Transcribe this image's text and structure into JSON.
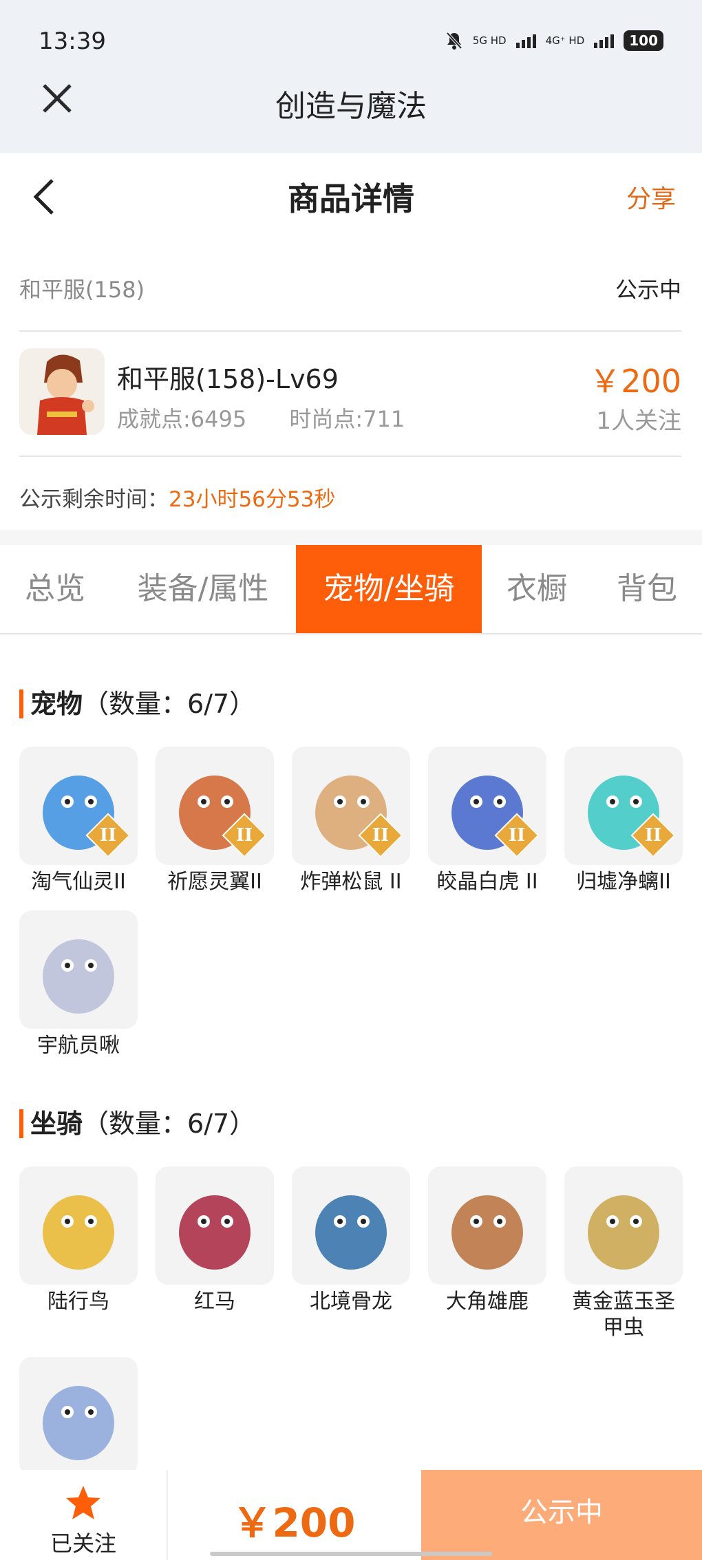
{
  "status_bar": {
    "time": "13:39",
    "net1": "5G HD",
    "net2": "4G⁺ HD",
    "battery": "100"
  },
  "app_bar": {
    "title": "创造与魔法"
  },
  "header": {
    "title": "商品详情",
    "share_label": "分享"
  },
  "listing": {
    "server": "和平服(158)",
    "status": "公示中",
    "character": "和平服(158)-Lv69",
    "achievement": "成就点:6495",
    "fashion": "时尚点:711",
    "price": "￥200",
    "followers": "1人关注",
    "timer_label": "公示剩余时间：",
    "timer_value": "23小时56分53秒"
  },
  "tabs": [
    {
      "label": "总览"
    },
    {
      "label": "装备/属性"
    },
    {
      "label": "宠物/坐骑",
      "active": true
    },
    {
      "label": "衣橱"
    },
    {
      "label": "背包"
    }
  ],
  "pets": {
    "title": "宠物",
    "count": "（数量：6/7）",
    "items": [
      {
        "name": "淘气仙灵II",
        "badge": "II",
        "color": "#3b8fe0"
      },
      {
        "name": "祈愿灵翼II",
        "badge": "II",
        "color": "#d0612b"
      },
      {
        "name": "炸弹松鼠 II",
        "badge": "II",
        "color": "#d9a36a"
      },
      {
        "name": "皎晶白虎 II",
        "badge": "II",
        "color": "#3f63c9"
      },
      {
        "name": "归墟净螭II",
        "badge": "II",
        "color": "#36c7c2"
      },
      {
        "name": "宇航员啾",
        "color": "#b9bdd8"
      }
    ]
  },
  "mounts": {
    "title": "坐骑",
    "count": "（数量：6/7）",
    "items": [
      {
        "name": "陆行鸟",
        "color": "#e8b52c"
      },
      {
        "name": "红马",
        "color": "#a8243e"
      },
      {
        "name": "北境骨龙",
        "color": "#2f6fa8"
      },
      {
        "name": "大角雄鹿",
        "color": "#b8703a"
      },
      {
        "name": "黄金蓝玉圣甲虫",
        "color": "#c9a44a"
      },
      {
        "name": "",
        "color": "#8aa6d8"
      }
    ]
  },
  "bottom": {
    "follow_label": "已关注",
    "price": "￥200",
    "status": "公示中"
  }
}
